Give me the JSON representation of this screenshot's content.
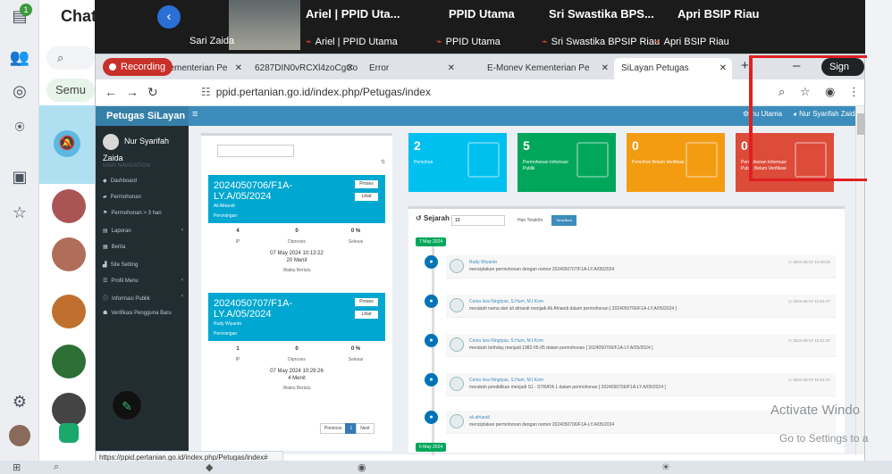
{
  "chat": {
    "title": "Chat",
    "search_icon": "search-icon",
    "filter": "Semu",
    "rail_badge": "1"
  },
  "call": {
    "tiles": [
      {
        "top": "Ariel | PPID Uta...",
        "bottom": "Ariel | PPID Utama"
      },
      {
        "top": "PPID Utama",
        "bottom": "PPID Utama"
      },
      {
        "top": "Sri Swastika BPS...",
        "bottom": "Sri Swastika BPSIP Riau"
      },
      {
        "top": "Apri BSIP Riau",
        "bottom": "Apri BSIP Riau"
      }
    ],
    "self_name": "Sari Zaida"
  },
  "browser": {
    "recording": "Recording",
    "tabs": [
      {
        "label": "y Kementerian Pe"
      },
      {
        "label": "6287DIN0vRCXl4zoCgCo"
      },
      {
        "label": "Error"
      },
      {
        "label": "E-Monev Kementerian Pe"
      },
      {
        "label": "SiLayan Petugas"
      }
    ],
    "signin": "Sign in",
    "url": "ppid.pertanian.go.id/index.php/Petugas/index",
    "status_url": "https://ppid.pertanian.go.id/index.php/Petugas/index#"
  },
  "app": {
    "brand": "Petugas SiLayan",
    "header_menu": "nu Utama",
    "header_user": "Nur Syarifah Zaida",
    "user": "Nur Syarifah Zaida",
    "nav_header": "MAIN NAVIGATION",
    "nav": [
      "Dashboard",
      "Permohonan",
      "Permohonan > 3 hari",
      "Laporan",
      "Berita",
      "Site Setting",
      "Profil Menu",
      "Informasi Publik",
      "Verifikasi Pengguna Baru"
    ],
    "requests": [
      {
        "no": "2024050706/F1A-LY.A/05/2024",
        "name": "Ali Afriandi",
        "type": "Perorangan",
        "proses": "Proses",
        "lihat": "Lihat",
        "ip": "4",
        "diproses": "0",
        "selesai": "0 %",
        "time": "07 May 2024 10:13:22",
        "dur": "20 Menit"
      },
      {
        "no": "2024050707/F1A-LY.A/05/2024",
        "name": "Rudy Wiyanto",
        "type": "Perorangan",
        "proses": "Proses",
        "lihat": "Lihat",
        "ip": "1",
        "diproses": "0",
        "selesai": "0 %",
        "time": "07 May 2024 10:29:26",
        "dur": "4 Menit"
      }
    ],
    "stat_labels": {
      "ip": "IP",
      "diproses": "Diproses",
      "selesai": "Selesai",
      "waktu": "Waktu Berlalu"
    },
    "pager": {
      "prev": "Previous",
      "page": "1",
      "next": "Next"
    },
    "boxes": [
      {
        "n": "2",
        "l": "Pemohon",
        "color": "#00c0ef"
      },
      {
        "n": "5",
        "l": "Permohonan Informasi Publik",
        "color": "#00a65a"
      },
      {
        "n": "0",
        "l": "Pemohon Belum Verifikasi",
        "color": "#f39c12"
      },
      {
        "n": "0",
        "l": "Permohonan Informasi Publik Belum Verifikasi",
        "color": "#dd4b39"
      }
    ],
    "timeline": {
      "title": "Sejarah",
      "days": "10",
      "hari": "Hari Terakhir",
      "btn": "Tampilkan",
      "date1": "7 May 2024",
      "date2": "6 May 2024",
      "items": [
        {
          "who": "Rudy Wiyanto",
          "what": "menciptakan permohonan dengan nomor 2024050707/F1A-LY.A/05/2024",
          "when": "2024-05-07 10:29:26"
        },
        {
          "who": "Cenia Isra Ningtyas, S.Hum, M.I.Kom",
          "what": "merubah nama dari ali afriandi menjadi Ali Afriandi dalam permohonan [ 2024050706/F1A-LY.A/05/2024 ]",
          "when": "2024-05-07 10:21:07"
        },
        {
          "who": "Cenia Isra Ningtyas, S.Hum, M.I.Kom",
          "what": "merubah birthday menjadi 1982-05-05 dalam permohonan [ 2024050706/F1A-LY.A/05/2024 ]",
          "when": "2024-05-07 10:21:07"
        },
        {
          "who": "Cenia Isra Ningtyas, S.Hum, M.I.Kom",
          "what": "merubah pendidikan menjadi S1 - STRATA 1 dalam permohonan [ 2024050706/F1A-LY.A/05/2024 ]",
          "when": "2024-05-07 10:21:07"
        },
        {
          "who": "ali afriandi",
          "what": "menciptakan permohonan dengan nomor 2024050706/F1A-LY.A/05/2024",
          "when": ""
        }
      ]
    }
  },
  "watermark": {
    "line1": "Activate Windo",
    "line2": "Go to Settings to a"
  }
}
